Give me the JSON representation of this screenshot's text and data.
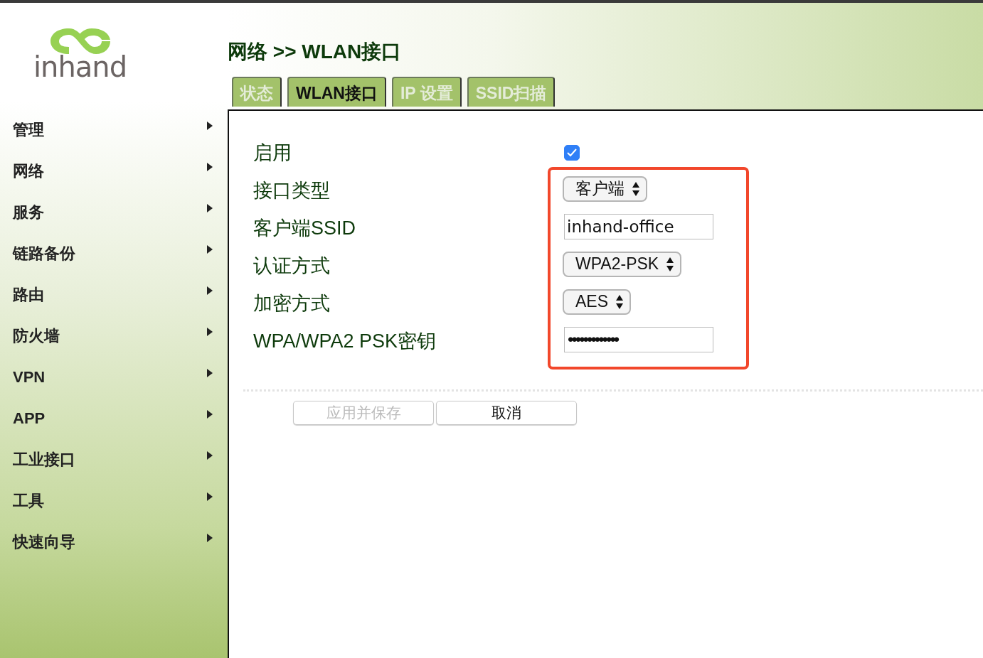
{
  "logo": {
    "text": "inhand"
  },
  "breadcrumb": "网络 >> WLAN接口",
  "tabs": [
    {
      "label": "状态",
      "selected": false
    },
    {
      "label": "WLAN接口",
      "selected": true
    },
    {
      "label": "IP 设置",
      "selected": false
    },
    {
      "label": "SSID扫描",
      "selected": false
    }
  ],
  "sidebar": {
    "items": [
      {
        "label": "管理"
      },
      {
        "label": "网络"
      },
      {
        "label": "服务"
      },
      {
        "label": "链路备份"
      },
      {
        "label": "路由"
      },
      {
        "label": "防火墙"
      },
      {
        "label": "VPN"
      },
      {
        "label": "APP"
      },
      {
        "label": "工业接口"
      },
      {
        "label": "工具"
      },
      {
        "label": "快速向导"
      }
    ]
  },
  "form": {
    "fields": [
      {
        "kind": "checkbox",
        "label": "启用",
        "checked": true
      }
    ],
    "highlighted_fields": [
      {
        "kind": "select",
        "label": "接口类型",
        "value": "客户端"
      },
      {
        "kind": "text",
        "label": "客户端SSID",
        "value": "inhand-office"
      },
      {
        "kind": "select",
        "label": "认证方式",
        "value": "WPA2-PSK"
      },
      {
        "kind": "select",
        "label": "加密方式",
        "value": "AES"
      },
      {
        "kind": "password",
        "label": "WPA/WPA2 PSK密钥",
        "value": "•••••••••••••"
      }
    ]
  },
  "buttons": [
    {
      "label": "应用并保存",
      "disabled": true
    },
    {
      "label": "取消",
      "disabled": false
    }
  ]
}
